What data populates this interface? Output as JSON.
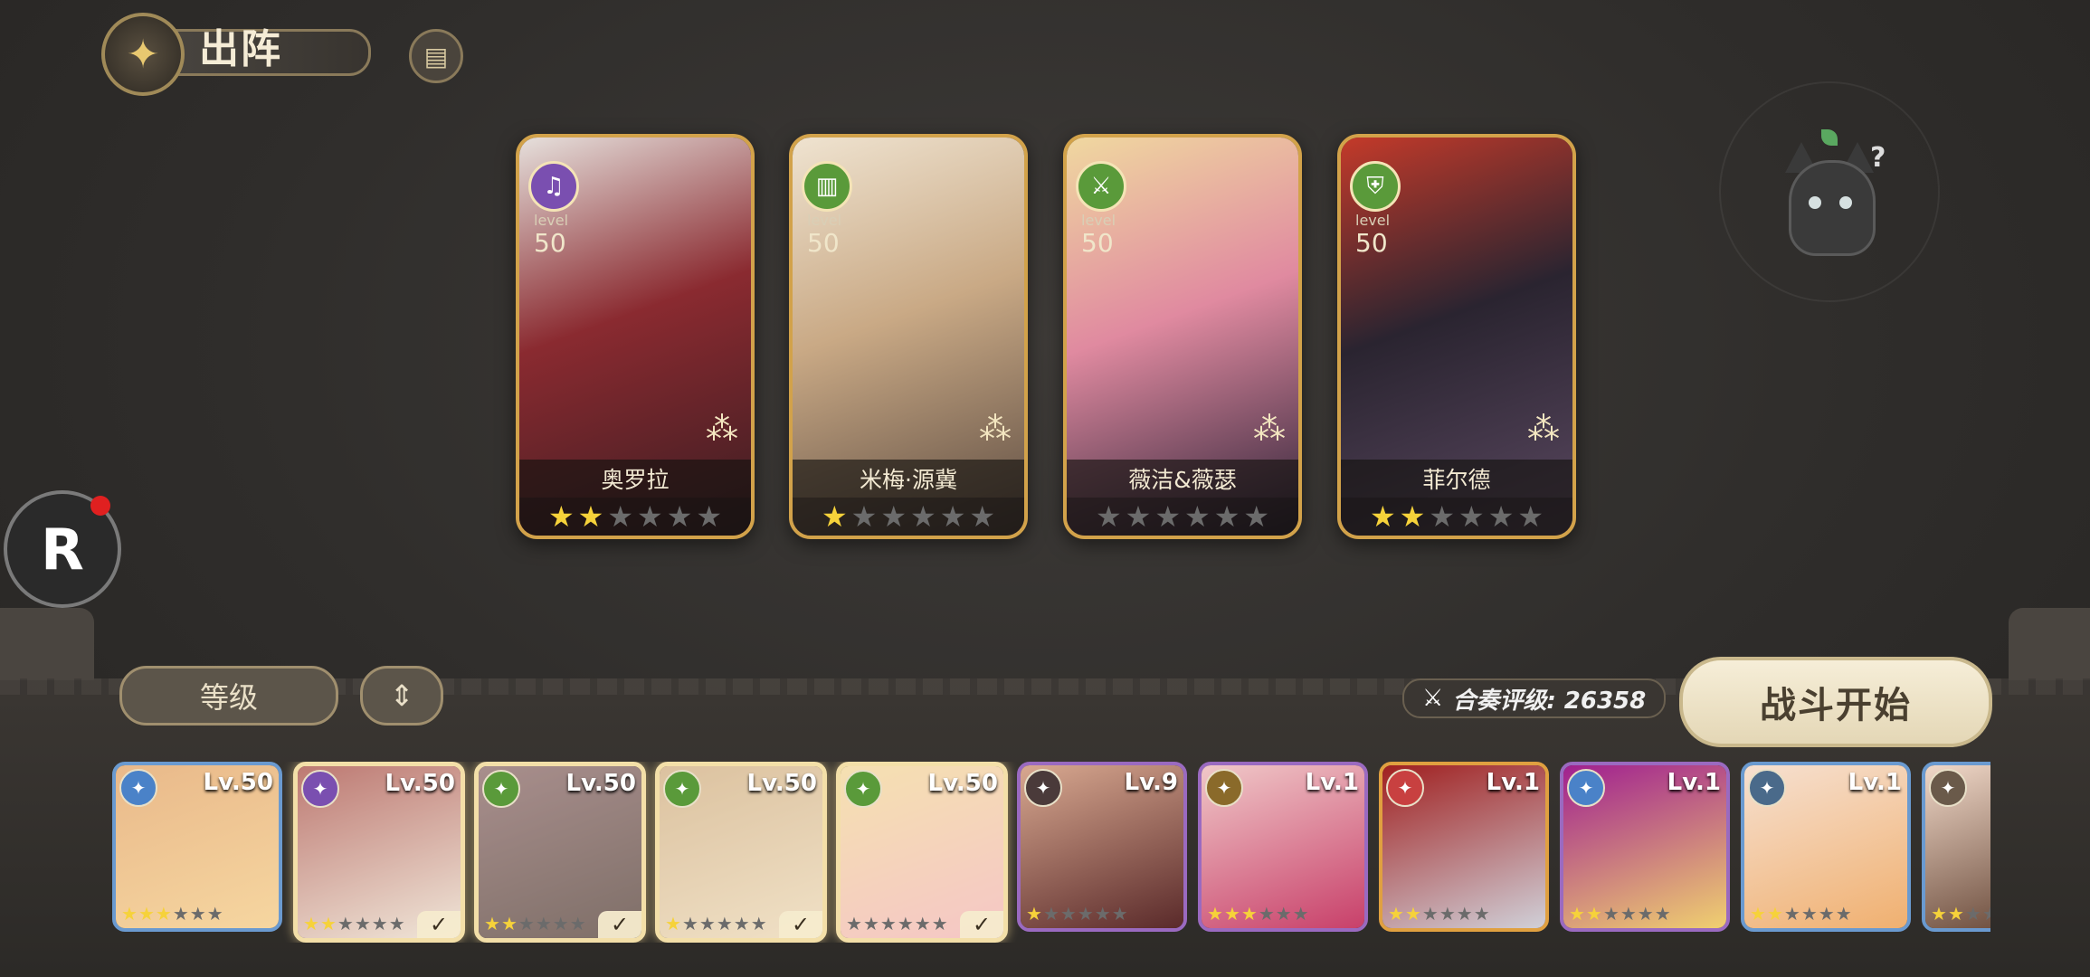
{
  "header": {
    "title": "出阵"
  },
  "icons": {
    "title_emblem": "sword-emblem-icon",
    "info": "document-icon",
    "r_button": "R"
  },
  "deployed": [
    {
      "name": "奥罗拉",
      "level_label": "level",
      "level": "50",
      "class_icon": "lyre-icon",
      "class_color": "#7a4fb0",
      "stars": 2,
      "art": [
        "#3a1d22",
        "#8a2a30",
        "#e6e0dc"
      ]
    },
    {
      "name": "米梅·源冀",
      "level_label": "level",
      "level": "50",
      "class_icon": "book-icon",
      "class_color": "#5a9a3a",
      "stars": 1,
      "art": [
        "#5b4a40",
        "#c9a985",
        "#efe3d0"
      ]
    },
    {
      "name": "薇洁&薇瑟",
      "level_label": "level",
      "level": "50",
      "class_icon": "sword-icon",
      "class_color": "#5a9a3a",
      "stars": 0,
      "art": [
        "#2a2035",
        "#e08aa0",
        "#f0d8a0"
      ]
    },
    {
      "name": "菲尔德",
      "level_label": "level",
      "level": "50",
      "class_icon": "shield-icon",
      "class_color": "#5a9a3a",
      "stars": 2,
      "art": [
        "#5a4860",
        "#2a2430",
        "#c43a2a"
      ]
    }
  ],
  "controls": {
    "sort_label": "等级",
    "order_icon": "⇕"
  },
  "power": {
    "label": "合奏评级: 26358"
  },
  "battle_button": "战斗开始",
  "roster": [
    {
      "level": "Lv.50",
      "class_color": "#4a82c8",
      "stars": 3,
      "selected": false,
      "border": "#6a9ad0",
      "art": [
        "#f6d6a0",
        "#e9b98a"
      ]
    },
    {
      "level": "Lv.50",
      "class_color": "#7a4fb0",
      "stars": 2,
      "selected": true,
      "border": "#f3dfa8",
      "art": [
        "#e8e0dc",
        "#9a3a40"
      ]
    },
    {
      "level": "Lv.50",
      "class_color": "#5a9a3a",
      "stars": 2,
      "selected": true,
      "border": "#f3dfa8",
      "art": [
        "#3a2a30",
        "#7a5a68"
      ]
    },
    {
      "level": "Lv.50",
      "class_color": "#5a9a3a",
      "stars": 1,
      "selected": true,
      "border": "#f3dfa8",
      "art": [
        "#e8d8c0",
        "#c9a985"
      ]
    },
    {
      "level": "Lv.50",
      "class_color": "#5a9a3a",
      "stars": 0,
      "selected": true,
      "border": "#f3dfa8",
      "art": [
        "#f0b0c0",
        "#f0d8a0"
      ]
    },
    {
      "level": "Lv.9",
      "class_color": "#4a3a3a",
      "stars": 1,
      "selected": false,
      "border": "#9a6ac0",
      "art": [
        "#5a2a2a",
        "#d8a890"
      ]
    },
    {
      "level": "Lv.1",
      "class_color": "#8a6a2a",
      "stars": 3,
      "selected": false,
      "border": "#9a6ac0",
      "art": [
        "#c8406a",
        "#f0c8c8"
      ]
    },
    {
      "level": "Lv.1",
      "class_color": "#c84040",
      "stars": 2,
      "selected": false,
      "border": "#e0a040",
      "art": [
        "#d0d0d8",
        "#a02020"
      ]
    },
    {
      "level": "Lv.1",
      "class_color": "#4a82c8",
      "stars": 2,
      "selected": false,
      "border": "#9a6ac0",
      "art": [
        "#f0d070",
        "#a02090"
      ]
    },
    {
      "level": "Lv.1",
      "class_color": "#4a6a8a",
      "stars": 2,
      "selected": false,
      "border": "#6a9ad0",
      "art": [
        "#f0b070",
        "#f6e0d0"
      ]
    },
    {
      "level": "",
      "class_color": "#6a5a4a",
      "stars": 2,
      "selected": false,
      "border": "#6a9ad0",
      "art": [
        "#5a3a2a",
        "#f0d8c8"
      ]
    }
  ]
}
